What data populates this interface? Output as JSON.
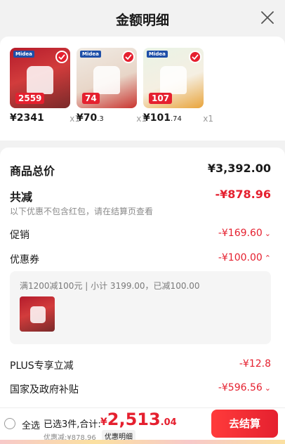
{
  "header": {
    "title": "金额明细",
    "close_icon": "close-icon"
  },
  "products": [
    {
      "price_int": "¥2341",
      "price_dec": "",
      "qty": "x1",
      "tag": "2559",
      "brand": "Midea"
    },
    {
      "price_int": "¥70",
      "price_dec": ".3",
      "qty": "x1",
      "tag": "74",
      "brand": "Midea"
    },
    {
      "price_int": "¥101",
      "price_dec": ".74",
      "qty": "x1",
      "tag": "107",
      "brand": "Midea"
    }
  ],
  "summary": {
    "total_label": "商品总价",
    "total_value": "¥3,392.00",
    "discount_label": "共减",
    "discount_value": "-¥878.96",
    "discount_note": "以下优惠不包含红包，请在结算页查看",
    "promo_label": "促销",
    "promo_value": "-¥169.60",
    "coupon_label": "优惠券",
    "coupon_value": "-¥100.00",
    "coupon_detail": "满1200减100元 | 小计 3199.00，已减100.00",
    "plus_label": "PLUS专享立减",
    "plus_value": "-¥12.8",
    "gov_label": "国家及政府补贴",
    "gov_value": "-¥596.56"
  },
  "footer": {
    "select_all": "全选",
    "selected_total": "已选3件,合计:",
    "price_symbol": "¥",
    "price_int": "2,513",
    "price_dec": ".04",
    "discount_sub": "优惠减:¥878.96",
    "detail_link": "优惠明细",
    "checkout_label": "去结算"
  },
  "colors": {
    "accent": "#e5202f",
    "background": "#f2f2f2"
  }
}
